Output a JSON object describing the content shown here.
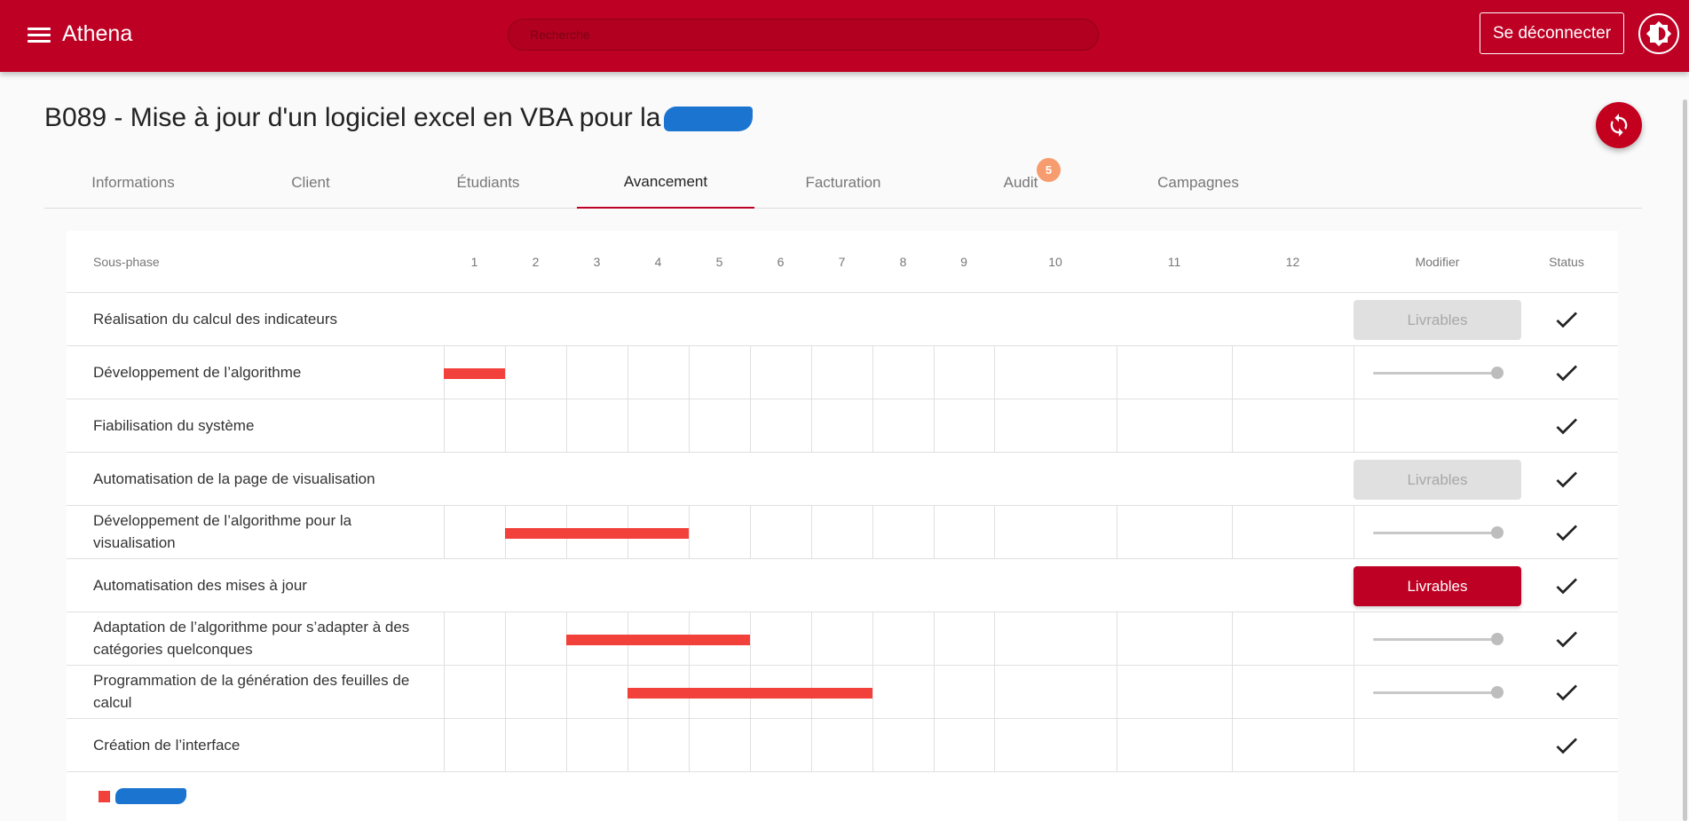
{
  "app": {
    "title": "Athena"
  },
  "header": {
    "search_placeholder": "Recherche",
    "logout_label": "Se déconnecter"
  },
  "page": {
    "title": "B089 - Mise à jour d'un logiciel excel en VBA pour la"
  },
  "tabs": [
    {
      "label": "Informations",
      "active": false
    },
    {
      "label": "Client",
      "active": false
    },
    {
      "label": "Étudiants",
      "active": false
    },
    {
      "label": "Avancement",
      "active": true
    },
    {
      "label": "Facturation",
      "active": false
    },
    {
      "label": "Audit",
      "active": false,
      "badge": "5"
    },
    {
      "label": "Campagnes",
      "active": false
    }
  ],
  "table": {
    "headers": {
      "subphase": "Sous-phase",
      "weeks": [
        "1",
        "2",
        "3",
        "4",
        "5",
        "6",
        "7",
        "8",
        "9",
        "10",
        "11",
        "12"
      ],
      "modify": "Modifier",
      "status": "Status"
    },
    "rows": [
      {
        "label": "Réalisation du calcul des indicateurs",
        "type": "phase",
        "button": "Livrables",
        "button_enabled": false,
        "status": "done"
      },
      {
        "label": "Développement de l’algorithme",
        "type": "subphase",
        "bar_start_week": 1,
        "bar_end_week": 1,
        "slider_value": 1.0,
        "status": "done"
      },
      {
        "label": "Fiabilisation du système",
        "type": "subphase",
        "status": "done"
      },
      {
        "label": "Automatisation de la page de visualisation",
        "type": "phase",
        "button": "Livrables",
        "button_enabled": false,
        "status": "done"
      },
      {
        "label": "Développement de l’algorithme pour la visualisation",
        "type": "subphase",
        "bar_start_week": 2,
        "bar_end_week": 4,
        "slider_value": 1.0,
        "status": "done"
      },
      {
        "label": "Automatisation des mises à jour",
        "type": "phase",
        "button": "Livrables",
        "button_enabled": true,
        "status": "done"
      },
      {
        "label": "Adaptation de l’algorithme pour s’adapter à des catégories quelconques",
        "type": "subphase",
        "bar_start_week": 3,
        "bar_end_week": 5,
        "slider_value": 1.0,
        "status": "done"
      },
      {
        "label": "Programmation de la génération des feuilles de calcul",
        "type": "subphase",
        "bar_start_week": 4,
        "bar_end_week": 7,
        "slider_value": 1.0,
        "status": "done"
      },
      {
        "label": "Création de l’interface",
        "type": "subphase",
        "status": "done"
      }
    ]
  },
  "colors": {
    "brand": "#bd0023",
    "bar": "#f2403a",
    "badge": "#f79c6e",
    "redaction": "#1b75d0"
  },
  "icons": {
    "menu": "menu-icon",
    "theme": "brightness-icon",
    "refresh": "refresh-icon",
    "status": "check-icon"
  }
}
